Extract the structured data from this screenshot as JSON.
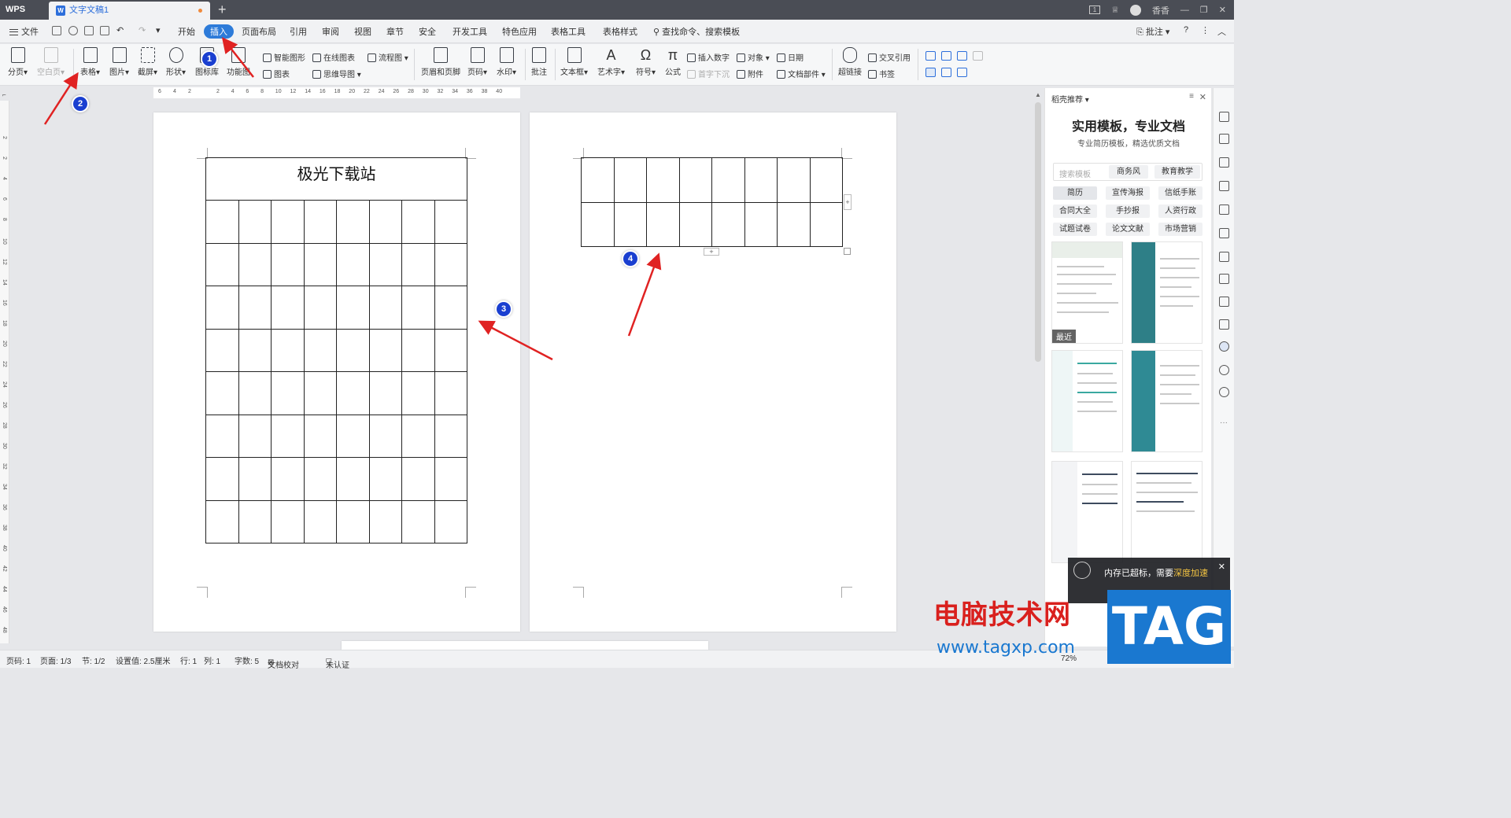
{
  "titlebar": {
    "app_logo": "WPS",
    "tab_title": "文字文稿1",
    "user_name": "香香",
    "window_badge": "1"
  },
  "menu": {
    "file_label": "文件",
    "items": [
      "开始",
      "插入",
      "页面布局",
      "引用",
      "审阅",
      "视图",
      "章节",
      "安全",
      "开发工具",
      "特色应用",
      "表格工具",
      "表格样式"
    ],
    "active_index": 1,
    "search_label": "查找命令、搜索模板",
    "comment_label": "批注"
  },
  "ribbon": {
    "page_break": "分页",
    "blank_page": "空白页",
    "table": "表格",
    "picture": "图片",
    "screenshot": "截屏",
    "shape": "形状",
    "icon_lib": "图标库",
    "function_chart": "功能图",
    "smart_shape": "智能图形",
    "online_chart": "在线图表",
    "flowchart": "流程图",
    "chart": "图表",
    "mindmap": "思维导图",
    "header_footer": "页眉和页脚",
    "page_number": "页码",
    "watermark": "水印",
    "comment": "批注",
    "textbox": "文本框",
    "wordart": "艺术字",
    "symbol": "符号",
    "formula": "公式",
    "insert_number": "插入数字",
    "drop_cap": "首字下沉",
    "object": "对象",
    "attachment": "附件",
    "date": "日期",
    "doc_parts": "文档部件",
    "hyperlink": "超链接",
    "cross_ref": "交叉引用",
    "bookmark": "书签"
  },
  "ruler": {
    "left_labels": [
      "6",
      "4",
      "2"
    ],
    "right_labels": [
      "2",
      "4",
      "6",
      "8",
      "10",
      "12",
      "14",
      "16",
      "18",
      "20",
      "22",
      "24",
      "26",
      "28",
      "30",
      "32",
      "34",
      "36",
      "38",
      "40"
    ],
    "vertical_labels": [
      "2",
      "2",
      "4",
      "6",
      "8",
      "10",
      "12",
      "14",
      "16",
      "18",
      "20",
      "22",
      "24",
      "26",
      "28",
      "30",
      "32",
      "34",
      "36",
      "38",
      "40",
      "42",
      "44",
      "46",
      "48"
    ]
  },
  "document": {
    "title_cell": "极光下载站",
    "page1_columns": 8,
    "page1_rows": 8,
    "page2_columns": 8,
    "page2_rows": 2
  },
  "annotations": [
    "1",
    "2",
    "3",
    "4"
  ],
  "right_panel": {
    "header": "稻壳推荐",
    "title": "实用模板，专业文档",
    "subtitle": "专业简历模板，精选优质文档",
    "search_placeholder": "搜索模板",
    "tags_row": [
      "商务风",
      "教育教学"
    ],
    "chips": [
      "简历",
      "宣传海报",
      "信纸手账",
      "合同大全",
      "手抄报",
      "人资行政",
      "试题试卷",
      "论文文献",
      "市场营销"
    ],
    "recent_badge": "最近"
  },
  "popup": {
    "text": "内存已超标，需要",
    "highlight": "深度加速"
  },
  "status": {
    "page_code": "页码: 1",
    "page": "页面: 1/3",
    "section": "节: 1/2",
    "setting": "设置值: 2.5厘米",
    "row": "行: 1",
    "col": "列: 1",
    "words": "字数: 5",
    "proof": "文档校对",
    "cert": "未认证",
    "zoom": "72%"
  },
  "watermark": {
    "text": "电脑技术网",
    "url": "www.tagxp.com",
    "tag": "TAG"
  },
  "colors": {
    "accent": "#2d7bd9",
    "annotation": "#1a3fd0",
    "arrow": "#e02222"
  }
}
